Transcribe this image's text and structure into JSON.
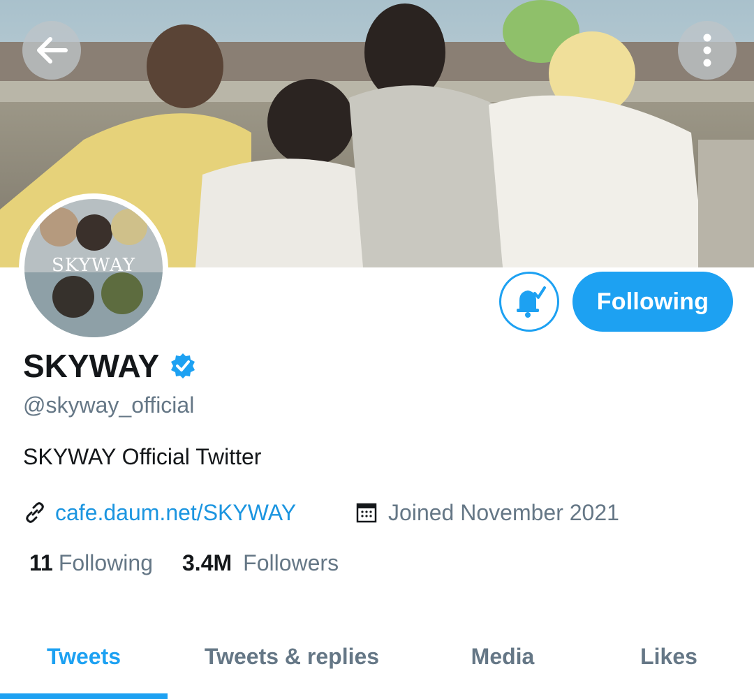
{
  "header": {
    "back_icon": "arrow-left-icon",
    "more_icon": "more-vertical-icon"
  },
  "profile": {
    "avatar_text": "SKYWAY",
    "display_name": "SKYWAY",
    "verified_icon": "verified-badge-icon",
    "handle": "@skyway_official",
    "bio": "SKYWAY Official Twitter",
    "link": "cafe.daum.net/SKYWAY",
    "link_icon": "link-icon",
    "joined": "Joined November 2021",
    "calendar_icon": "calendar-icon"
  },
  "actions": {
    "notification_icon": "bell-check-icon",
    "following_label": "Following"
  },
  "stats": {
    "following_count": "11",
    "following_label": "Following",
    "followers_count": "3.4M",
    "followers_label": "Followers"
  },
  "tabs": [
    {
      "label": "Tweets",
      "active": true
    },
    {
      "label": "Tweets & replies",
      "active": false
    },
    {
      "label": "Media",
      "active": false
    },
    {
      "label": "Likes",
      "active": false
    }
  ],
  "colors": {
    "accent": "#1da1f2",
    "link": "#1b95e0",
    "text_primary": "#14171a",
    "text_secondary": "#657786"
  }
}
